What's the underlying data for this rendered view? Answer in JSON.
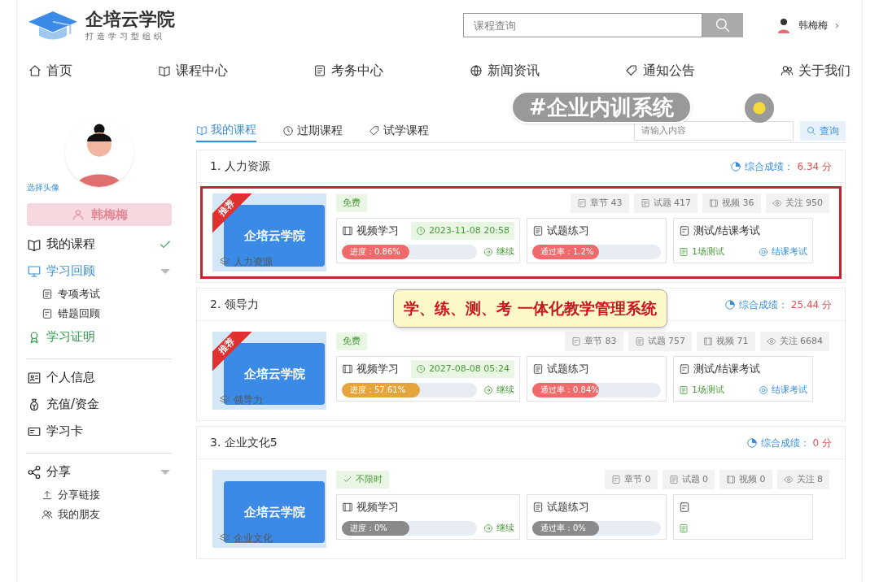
{
  "logo": {
    "title": "企培云学院",
    "slogan": "打造学习型组织"
  },
  "search": {
    "placeholder": "课程查询"
  },
  "user": {
    "name": "韩梅梅",
    "chevron": "›"
  },
  "nav": [
    {
      "label": "首页"
    },
    {
      "label": "课程中心"
    },
    {
      "label": "考务中心"
    },
    {
      "label": "新闻资讯"
    },
    {
      "label": "通知公告"
    },
    {
      "label": "关于我们"
    }
  ],
  "profile": {
    "choose_avatar": "选择头像",
    "name": "韩梅梅"
  },
  "sidebar": [
    [
      {
        "label": "我的课程",
        "color": "#222222",
        "kind": "checked"
      },
      {
        "label": "学习回顾",
        "color": "#3a8ed8",
        "kind": "collapsible",
        "children": [
          {
            "label": "专项考试"
          },
          {
            "label": "错题回顾"
          }
        ]
      },
      {
        "label": "学习证明",
        "color": "#2e9a4a",
        "kind": "plain"
      }
    ],
    [
      {
        "label": "个人信息",
        "color": "#222222",
        "kind": "plain"
      },
      {
        "label": "充值/资金",
        "color": "#222222",
        "kind": "plain"
      },
      {
        "label": "学习卡",
        "color": "#222222",
        "kind": "plain"
      }
    ],
    [
      {
        "label": "分享",
        "color": "#222222",
        "kind": "collapsible",
        "children": [
          {
            "label": "分享链接"
          },
          {
            "label": "我的朋友"
          }
        ]
      }
    ]
  ],
  "tabs": [
    {
      "label": "我的课程",
      "selected": true
    },
    {
      "label": "过期课程",
      "selected": false
    },
    {
      "label": "试学课程",
      "selected": false
    }
  ],
  "course_search": {
    "placeholder": "请输入内容",
    "button": "查询"
  },
  "overlay_tag": "#企业内训系统",
  "callout": "学、练、测、考 一体化教学管理系统",
  "courses": [
    {
      "title": "1. 人力资源",
      "score_label": "综合成绩：",
      "score": "6.34 分",
      "highlighted": true,
      "thumb": {
        "brand": "企培云学院",
        "ribbon": "推荐",
        "name": "人力资源"
      },
      "badge": {
        "text": "免费",
        "checked": false
      },
      "stats": [
        "章节 43",
        "试题 417",
        "视频 36",
        "关注 950"
      ],
      "video": {
        "title": "视频学习",
        "date": "2023-11-08 20:58",
        "progress": "进度：0.86%",
        "level": 0.5,
        "color": "#ef6b6b",
        "action": "继续"
      },
      "practice": {
        "title": "试题练习",
        "progress": "通过率：1.2%",
        "level": 0.52,
        "color": "#ef6b6b"
      },
      "exam": {
        "title": "测试/结课考试",
        "count": "1场测试",
        "action": "结课考试"
      }
    },
    {
      "title": "2. 领导力",
      "score_label": "综合成绩：",
      "score": "25.44 分",
      "highlighted": false,
      "thumb": {
        "brand": "企培云学院",
        "ribbon": "推荐",
        "name": "领导力"
      },
      "badge": {
        "text": "免费",
        "checked": false
      },
      "stats": [
        "章节 83",
        "试题 757",
        "视频 71",
        "关注 6684"
      ],
      "video": {
        "title": "视频学习",
        "date": "2027-08-08 05:24",
        "progress": "进度：57.61%",
        "level": 0.58,
        "color": "#e5a53c",
        "action": "继续"
      },
      "practice": {
        "title": "试题练习",
        "progress": "通过率：0.84%",
        "level": 0.52,
        "color": "#ef6b6b"
      },
      "exam": {
        "title": "测试/结课考试",
        "count": "1场测试",
        "action": "结课考试"
      }
    },
    {
      "title": "3. 企业文化5",
      "score_label": "综合成绩：",
      "score": "0 分",
      "highlighted": false,
      "thumb": {
        "brand": "企培云学院",
        "name": "企业文化"
      },
      "badge": {
        "text": "不限时",
        "checked": true
      },
      "stats": [
        "章节 0",
        "试题 0",
        "视频 0",
        "关注 8"
      ],
      "video": {
        "title": "视频学习",
        "progress": "进度：0%",
        "level": 0.5,
        "color": "#8a8a8a",
        "action": "继续"
      },
      "practice": {
        "title": "试题练习",
        "progress": "通过率：0%",
        "level": 0.52,
        "color": "#8a8a8a"
      }
    }
  ]
}
